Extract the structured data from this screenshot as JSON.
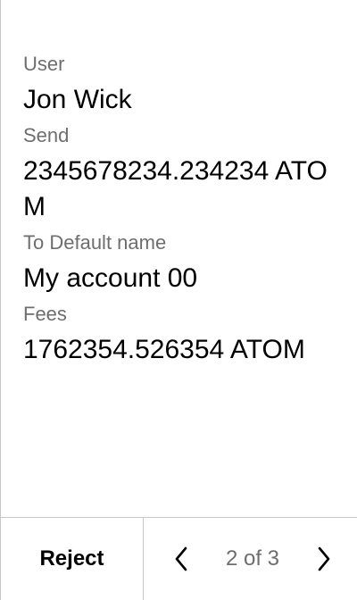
{
  "fields": {
    "user": {
      "label": "User",
      "value": "Jon Wick"
    },
    "send": {
      "label": "Send",
      "value": "2345678234.234234 ATOM"
    },
    "to": {
      "label": "To Default name",
      "value": "My account 00"
    },
    "fees": {
      "label": "Fees",
      "value": "1762354.526354 ATOM"
    }
  },
  "footer": {
    "reject_label": "Reject",
    "page_indicator": "2 of 3",
    "prev_icon": "chevron-left-icon",
    "next_icon": "chevron-right-icon"
  },
  "colors": {
    "text": "#000000",
    "label": "#6e6e6e",
    "divider": "#c8c8c8",
    "background": "#ffffff"
  }
}
